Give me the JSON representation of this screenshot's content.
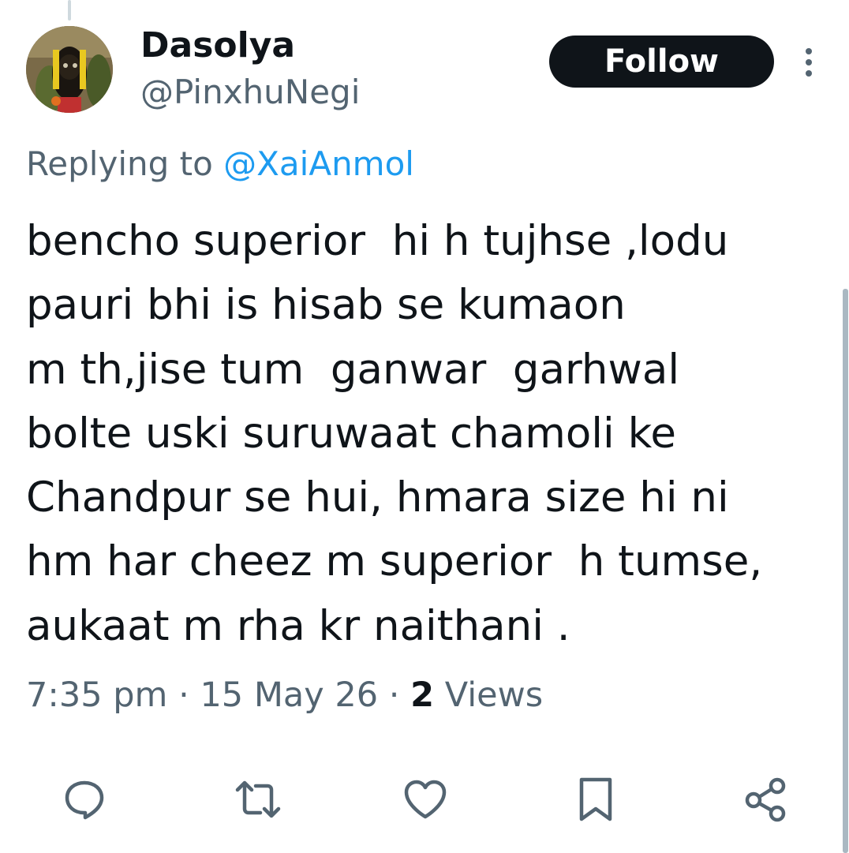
{
  "tweet": {
    "display_name": "Dasolya",
    "handle": "@PinxhuNegi",
    "follow_label": "Follow",
    "reply_prefix": "Replying to",
    "reply_mention": "@XaiAnmol",
    "text_lines": [
      "bencho superior  hi h tujhse ,lodu",
      "pauri bhi is hisab se kumaon",
      "m th,jise tum  ganwar  garhwal",
      "bolte uski suruwaat chamoli ke",
      "Chandpur se hui, hmara size hi ni",
      "hm har cheez m superior  h tumse,",
      "aukaat m rha kr naithani ."
    ],
    "time": "7:35 pm",
    "separator": "·",
    "date": "15 May 26",
    "views_count": "2",
    "views_label": "Views"
  },
  "actions": {
    "reply_icon": "reply-icon",
    "retweet_icon": "retweet-icon",
    "like_icon": "like-icon",
    "bookmark_icon": "bookmark-icon",
    "share_icon": "share-icon"
  },
  "colors": {
    "text_primary": "#0f1419",
    "text_secondary": "#536471",
    "accent": "#1d9bf0",
    "icon": "#536471",
    "follow_bg": "#0f1419"
  }
}
